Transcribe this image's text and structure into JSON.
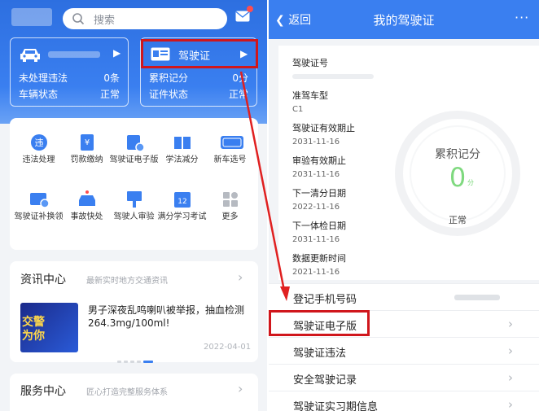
{
  "left": {
    "search": {
      "placeholder": "搜索"
    },
    "vehicle_card": {
      "violations_label": "未处理违法",
      "violations_value": "0条",
      "status_label": "车辆状态",
      "status_value": "正常"
    },
    "license_card": {
      "title": "驾驶证",
      "points_label": "累积记分",
      "points_value": "0分",
      "status_label": "证件状态",
      "status_value": "正常"
    },
    "services": [
      {
        "label": "违法处理",
        "icon": "violation-icon"
      },
      {
        "label": "罚款缴纳",
        "icon": "fine-payment-icon"
      },
      {
        "label": "驾驶证电子版",
        "icon": "e-license-icon"
      },
      {
        "label": "学法减分",
        "icon": "study-book-icon"
      },
      {
        "label": "新车选号",
        "icon": "new-plate-icon"
      },
      {
        "label": "驾驶证补换领",
        "icon": "license-renew-icon"
      },
      {
        "label": "事故快处",
        "icon": "accident-car-icon"
      },
      {
        "label": "驾驶人审验",
        "icon": "driver-review-icon"
      },
      {
        "label": "满分学习考试",
        "icon": "calendar-12-icon"
      },
      {
        "label": "更多",
        "icon": "more-grid-icon"
      }
    ],
    "news": {
      "title": "资讯中心",
      "subtitle": "最新实时地方交通资讯",
      "headline": "男子深夜乱鸣喇叭被举报，抽血检测264.3mg/100ml!",
      "thumb_text": "交警\n为你",
      "date": "2022-04-01"
    },
    "service_center": {
      "title": "服务中心",
      "subtitle": "匠心打造完整服务体系"
    }
  },
  "right": {
    "back_label": "返回",
    "title": "我的驾驶证",
    "more_label": "···",
    "fields": [
      {
        "label": "驾驶证号",
        "value": ""
      },
      {
        "label": "准驾车型",
        "value": "C1"
      },
      {
        "label": "驾驶证有效期止",
        "value": "2031-11-16"
      },
      {
        "label": "审验有效期止",
        "value": "2031-11-16"
      },
      {
        "label": "下一清分日期",
        "value": "2022-11-16"
      },
      {
        "label": "下一体检日期",
        "value": "2031-11-16"
      },
      {
        "label": "数据更新时间",
        "value": "2021-11-16"
      }
    ],
    "gauge": {
      "label": "累积记分",
      "value": "0",
      "unit": "分",
      "status": "正常",
      "level": 0
    },
    "menu": [
      {
        "label": "登记手机号码"
      },
      {
        "label": "驾驶证电子版"
      },
      {
        "label": "驾驶证违法"
      },
      {
        "label": "安全驾驶记录"
      },
      {
        "label": "驾驶证实习期信息"
      }
    ]
  },
  "colors": {
    "brand_blue": "#3a7ff0",
    "highlight_red": "#d0161c",
    "gauge_green": "#7fd97f"
  }
}
